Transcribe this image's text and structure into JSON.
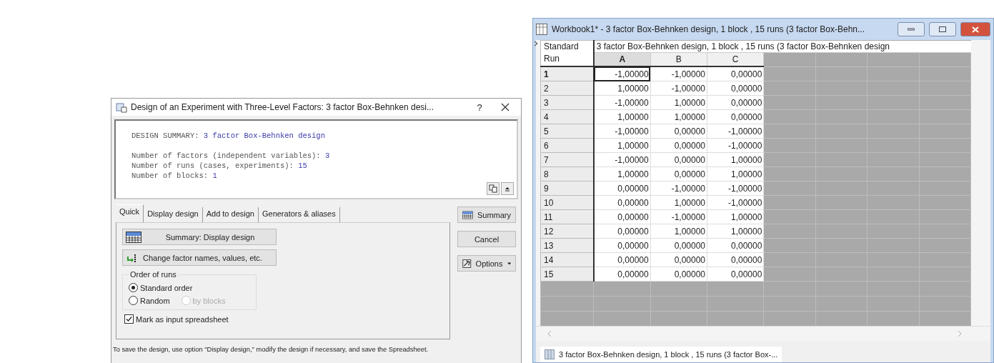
{
  "dialog": {
    "title": "Design of an Experiment with Three-Level Factors: 3 factor Box-Behnken desi...",
    "help": "?",
    "summary": {
      "heading_label": "DESIGN SUMMARY:",
      "heading_value": "3 factor Box-Behnken design",
      "lines": [
        {
          "label": "Number of factors (independent variables):",
          "value": "3"
        },
        {
          "label": "Number of runs (cases, experiments):",
          "value": "15"
        },
        {
          "label": "Number of blocks:",
          "value": "1"
        }
      ]
    },
    "tabs": [
      {
        "label": "Quick",
        "selected": true
      },
      {
        "label": "Display design",
        "selected": false
      },
      {
        "label": "Add to design",
        "selected": false
      },
      {
        "label": "Generators & aliases",
        "selected": false
      }
    ],
    "actions": [
      {
        "label": "Summary:  Display design",
        "kind": "summary"
      },
      {
        "label": "Change factor names, values, etc.",
        "kind": "change"
      }
    ],
    "order_group": {
      "title": "Order of runs",
      "options": [
        {
          "label": "Standard order",
          "selected": true,
          "disabled": false
        },
        {
          "label": "Random",
          "selected": false,
          "disabled": false
        },
        {
          "label": "by blocks",
          "selected": false,
          "disabled": true
        }
      ]
    },
    "checkbox": {
      "label": "Mark as input spreadsheet",
      "checked": true
    },
    "side_buttons": [
      {
        "label": "Summary",
        "kind": "summary"
      },
      {
        "label": "Cancel",
        "kind": "plain"
      },
      {
        "label": "Options",
        "kind": "options"
      }
    ],
    "footer": "To save the design, use option \"Display design,\"  modify the design if necessary, and save the Spreadsheet."
  },
  "workbook": {
    "title": "Workbook1* - 3 factor Box-Behnken design, 1 block , 15 runs (3 factor Box-Behn...",
    "corner_header": [
      "Standard",
      "Run"
    ],
    "spanning_title": "3 factor Box-Behnken design, 1 block , 15 runs (3 factor Box-Behnken design",
    "columns": [
      {
        "label": "A",
        "current": true
      },
      {
        "label": "B",
        "current": false
      },
      {
        "label": "C",
        "current": false
      }
    ],
    "rows": [
      {
        "run": "1",
        "current": true,
        "cells": [
          "-1,00000",
          "-1,00000",
          "0,00000"
        ]
      },
      {
        "run": "2",
        "current": false,
        "cells": [
          "1,00000",
          "-1,00000",
          "0,00000"
        ]
      },
      {
        "run": "3",
        "current": false,
        "cells": [
          "-1,00000",
          "1,00000",
          "0,00000"
        ]
      },
      {
        "run": "4",
        "current": false,
        "cells": [
          "1,00000",
          "1,00000",
          "0,00000"
        ]
      },
      {
        "run": "5",
        "current": false,
        "cells": [
          "-1,00000",
          "0,00000",
          "-1,00000"
        ]
      },
      {
        "run": "6",
        "current": false,
        "cells": [
          "1,00000",
          "0,00000",
          "-1,00000"
        ]
      },
      {
        "run": "7",
        "current": false,
        "cells": [
          "-1,00000",
          "0,00000",
          "1,00000"
        ]
      },
      {
        "run": "8",
        "current": false,
        "cells": [
          "1,00000",
          "0,00000",
          "1,00000"
        ]
      },
      {
        "run": "9",
        "current": false,
        "cells": [
          "0,00000",
          "-1,00000",
          "-1,00000"
        ]
      },
      {
        "run": "10",
        "current": false,
        "cells": [
          "0,00000",
          "1,00000",
          "-1,00000"
        ]
      },
      {
        "run": "11",
        "current": false,
        "cells": [
          "0,00000",
          "-1,00000",
          "1,00000"
        ]
      },
      {
        "run": "12",
        "current": false,
        "cells": [
          "0,00000",
          "1,00000",
          "1,00000"
        ]
      },
      {
        "run": "13",
        "current": false,
        "cells": [
          "0,00000",
          "0,00000",
          "0,00000"
        ]
      },
      {
        "run": "14",
        "current": false,
        "cells": [
          "0,00000",
          "0,00000",
          "0,00000"
        ]
      },
      {
        "run": "15",
        "current": false,
        "cells": [
          "0,00000",
          "0,00000",
          "0,00000"
        ]
      }
    ],
    "sheet_tab": "3 factor Box-Behnken design, 1 block , 15 runs (3 factor Box-..."
  }
}
